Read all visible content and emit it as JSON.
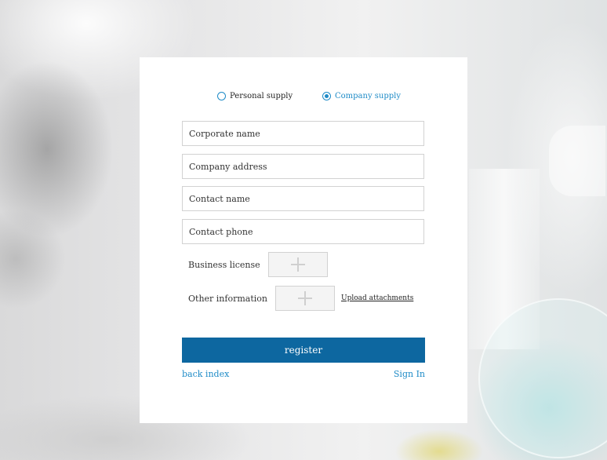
{
  "supply_type": {
    "options": [
      {
        "label": "Personal supply",
        "selected": false
      },
      {
        "label": "Company supply",
        "selected": true
      }
    ]
  },
  "form": {
    "corporate_name_placeholder": "Corporate name",
    "company_address_placeholder": "Company address",
    "contact_name_placeholder": "Contact name",
    "contact_phone_placeholder": "Contact phone",
    "business_license_label": "Business license",
    "other_information_label": "Other information",
    "upload_attachments_label": "Upload attachments",
    "register_label": "register"
  },
  "footer": {
    "back_index_label": "back index",
    "sign_in_label": "Sign In"
  },
  "colors": {
    "accent": "#1e8bc7",
    "button": "#0d67a0",
    "border": "#d2d2d2"
  },
  "icons": {
    "upload": "plus-icon"
  }
}
